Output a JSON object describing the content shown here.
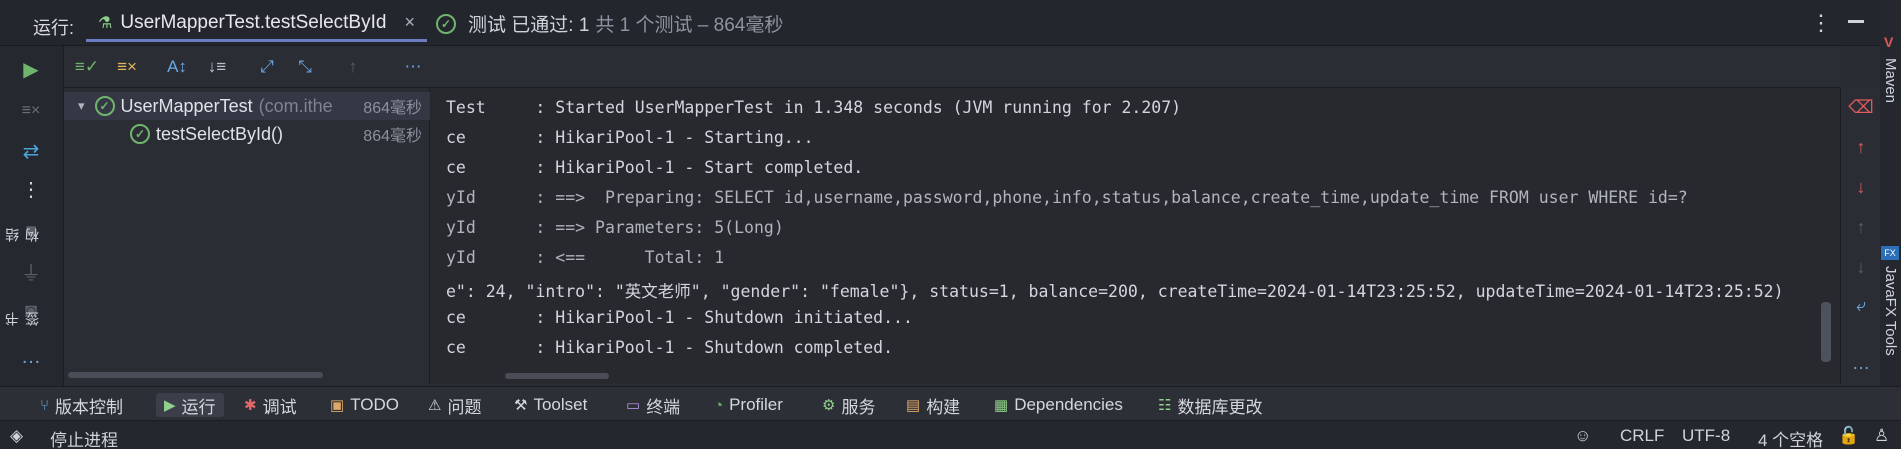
{
  "header": {
    "run_label": "运行:",
    "tab_title": "UserMapperTest.testSelectById",
    "close_glyph": "×"
  },
  "toolbar": {
    "status_passed": "测试 已通过: 1",
    "status_total": "共 1 个测试 – 864毫秒"
  },
  "tree": {
    "rows": [
      {
        "label": "UserMapperTest",
        "package": "(com.ithe",
        "time": "864毫秒"
      },
      {
        "label": "testSelectById()",
        "time": "864毫秒"
      }
    ]
  },
  "console": {
    "lines": [
      "Test     : Started UserMapperTest in 1.348 seconds (JVM running for 2.207)",
      "ce       : HikariPool-1 - Starting...",
      "ce       : HikariPool-1 - Start completed.",
      "yId      : ==>  Preparing: SELECT id,username,password,phone,info,status,balance,create_time,update_time FROM user WHERE id=?",
      "yId      : ==> Parameters: 5(Long)",
      "yId      : <==      Total: 1",
      "e\": 24, \"intro\": \"英文老师\", \"gender\": \"female\"}, status=1, balance=200, createTime=2024-01-14T23:25:52, updateTime=2024-01-14T23:25:52)",
      "ce       : HikariPool-1 - Shutdown initiated...",
      "ce       : HikariPool-1 - Shutdown completed."
    ]
  },
  "left_labels": {
    "structure": "结构",
    "bookmarks": "书签"
  },
  "right_labels": {
    "maven": "Maven",
    "javafx": "JavaFX Tools"
  },
  "bottom_tabs": [
    {
      "label": "版本控制",
      "icon": "branch-icon",
      "color": "#6aa6e0"
    },
    {
      "label": "运行",
      "icon": "run-icon",
      "color": "#8fd18a"
    },
    {
      "label": "调试",
      "icon": "bug-icon",
      "color": "#e06a6a"
    },
    {
      "label": "TODO",
      "icon": "todo-icon",
      "color": "#e0a86a"
    },
    {
      "label": "问题",
      "icon": "problems-icon",
      "color": "#cfd3dc"
    },
    {
      "label": "Toolset",
      "icon": "toolset-icon",
      "color": "#cfd3dc"
    },
    {
      "label": "终端",
      "icon": "terminal-icon",
      "color": "#b690e0"
    },
    {
      "label": "Profiler",
      "icon": "profiler-icon",
      "color": "#6fb56b"
    },
    {
      "label": "服务",
      "icon": "services-icon",
      "color": "#8fd18a"
    },
    {
      "label": "构建",
      "icon": "build-icon",
      "color": "#e0a86a"
    },
    {
      "label": "Dependencies",
      "icon": "dependencies-icon",
      "color": "#8fd18a"
    },
    {
      "label": "数据库更改",
      "icon": "database-icon",
      "color": "#8fd18a"
    }
  ],
  "statusbar": {
    "stop_process": "停止进程",
    "line_sep": "CRLF",
    "encoding": "UTF-8",
    "indent": "4 个空格"
  },
  "colors": {
    "accent": "#6b7cc2",
    "pass": "#6fb56b",
    "error": "#e05a5a"
  }
}
